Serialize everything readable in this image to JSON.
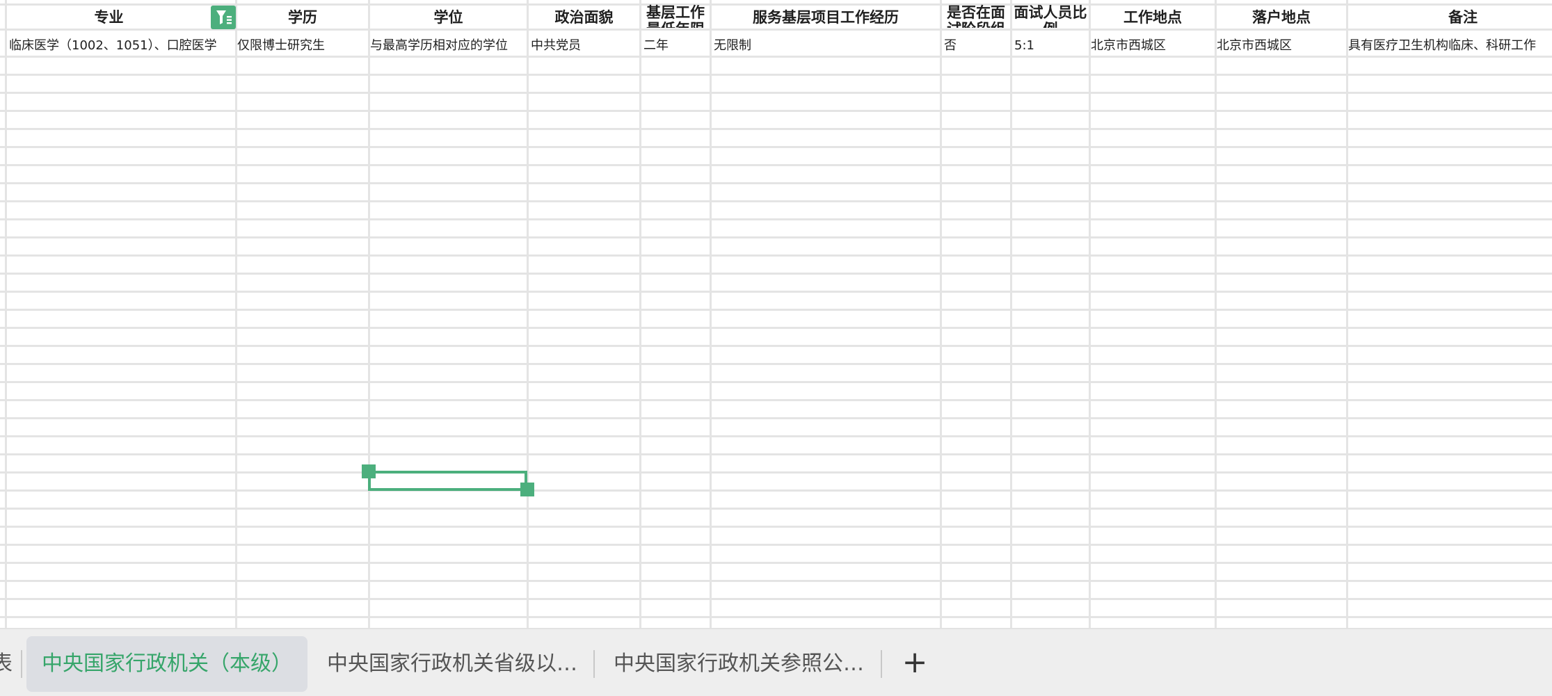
{
  "accent_color": "#4caf7d",
  "header": {
    "specialty": "专业",
    "education": "学历",
    "degree": "学位",
    "political": "政治面貌",
    "grassroots_years": "基层工作最低年限",
    "service_project": "服务基层项目工作经历",
    "professional_test": "是否在面试阶段组织专业能力测试",
    "interview_ratio": "面试人员比例",
    "work_location": "工作地点",
    "hukou_location": "落户地点",
    "remarks": "备注"
  },
  "row1": {
    "specialty": "临床医学（1002、1051）、口腔医学",
    "education": "仅限博士研究生",
    "degree": "与最高学历相对应的学位",
    "political": "中共党员",
    "grassroots_years": "二年",
    "service_project": "无限制",
    "professional_test": "否",
    "interview_ratio": "5:1",
    "work_location": "北京市西城区",
    "hukou_location": "北京市西城区",
    "remarks": "具有医疗卫生机构临床、科研工作"
  },
  "icons": {
    "filter": "filter-icon",
    "add_sheet": "plus-icon"
  },
  "tabs": {
    "partial_left": "表",
    "active": "中央国家行政机关（本级）",
    "second": "中央国家行政机关省级以…",
    "third": "中央国家行政机关参照公…",
    "add": "+"
  }
}
